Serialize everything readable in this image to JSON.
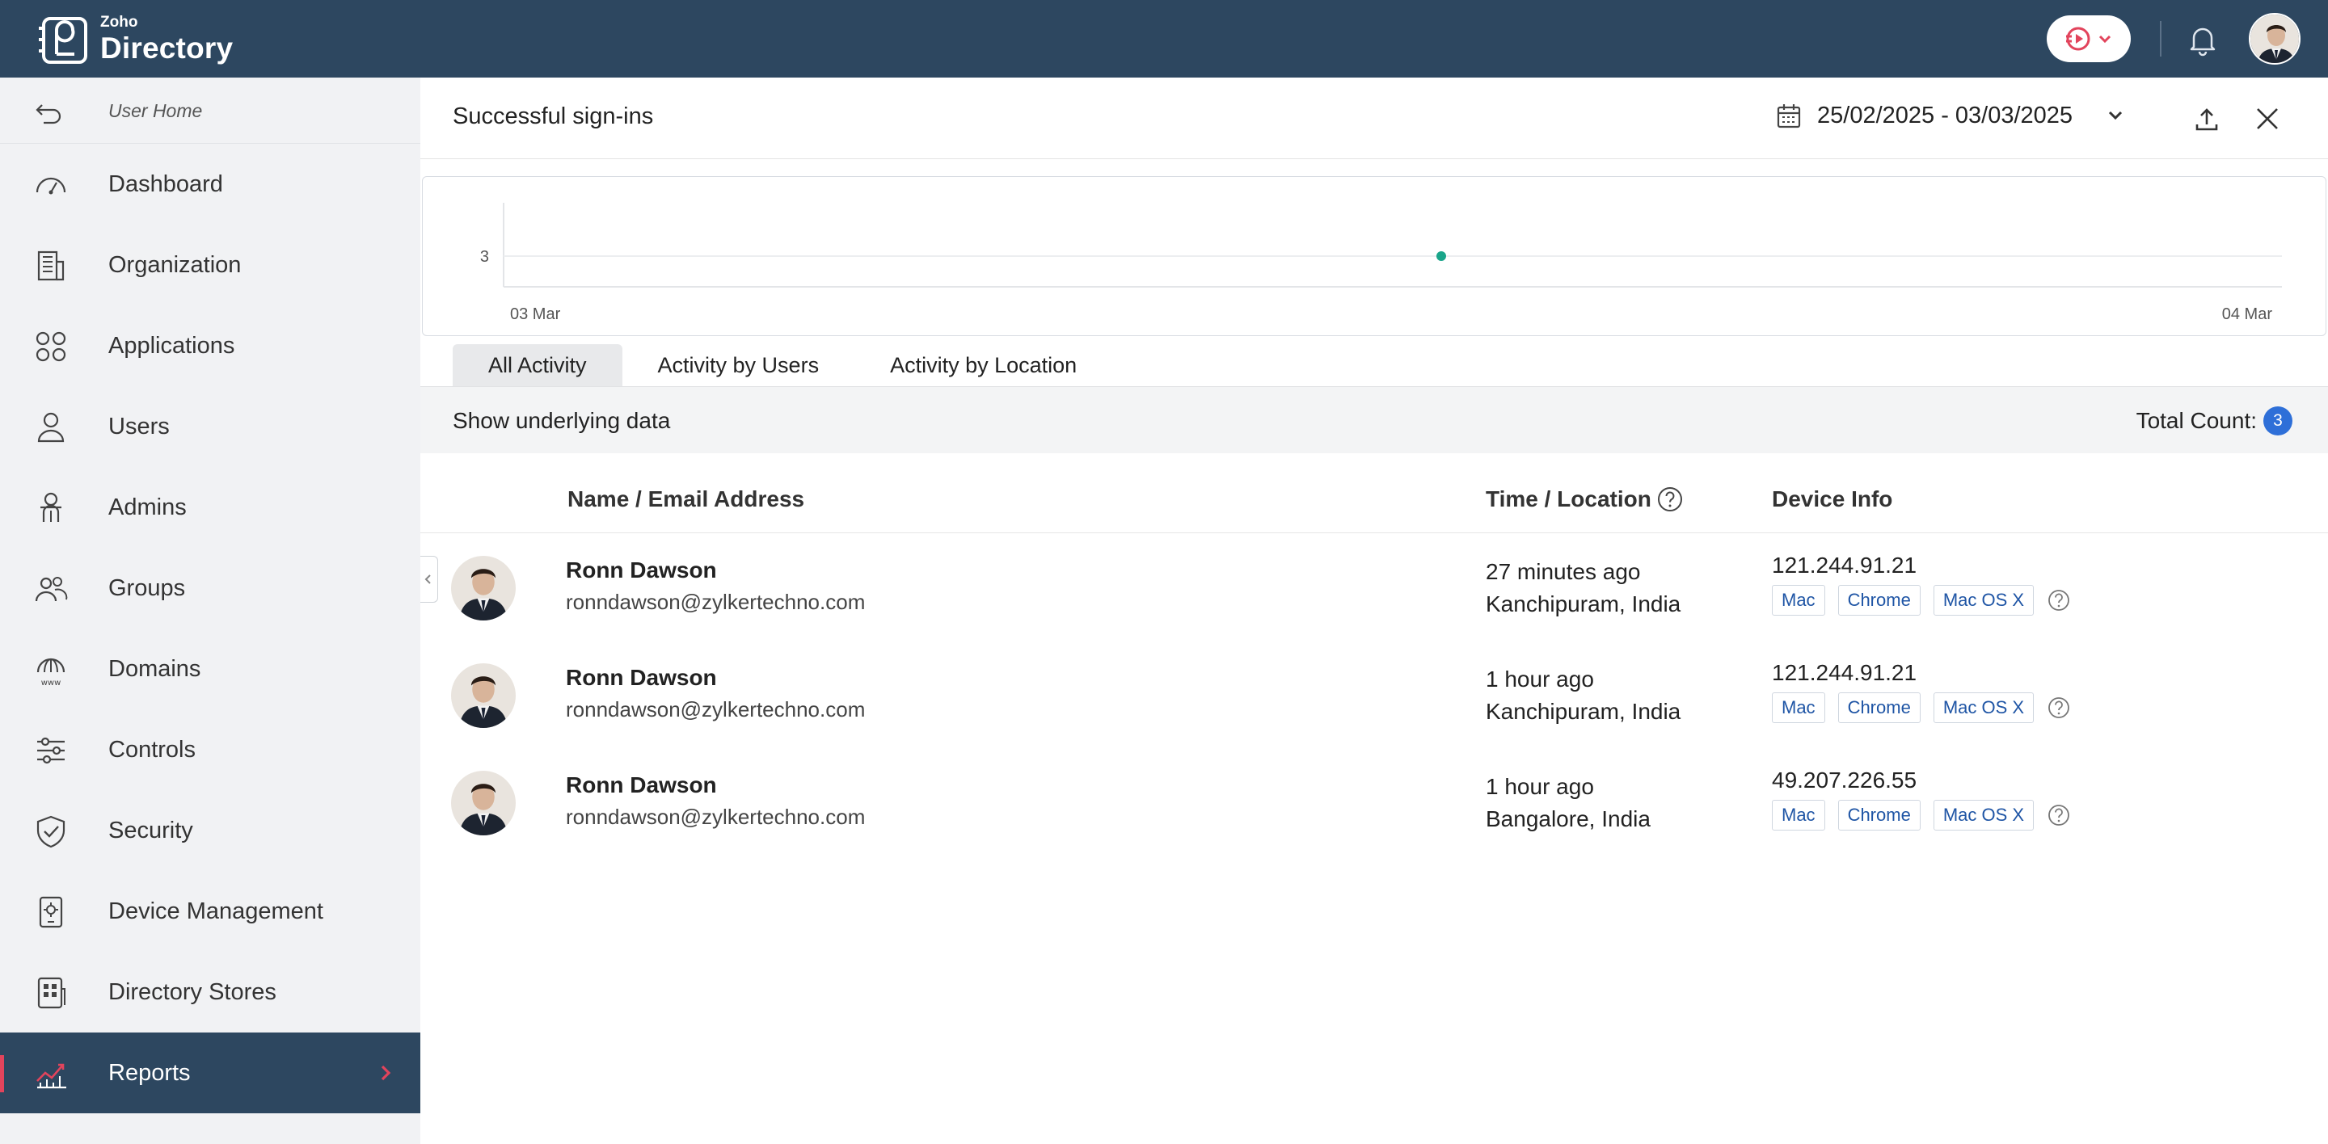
{
  "header": {
    "brand_small": "Zoho",
    "brand_name": "Directory",
    "bg_color": "#2d4760"
  },
  "sidebar": {
    "user_home": "User Home",
    "items": [
      {
        "label": "Dashboard",
        "icon": "speedometer-icon"
      },
      {
        "label": "Organization",
        "icon": "building-icon"
      },
      {
        "label": "Applications",
        "icon": "apps-grid-icon"
      },
      {
        "label": "Users",
        "icon": "user-icon"
      },
      {
        "label": "Admins",
        "icon": "admin-icon"
      },
      {
        "label": "Groups",
        "icon": "group-icon"
      },
      {
        "label": "Domains",
        "icon": "www-globe-icon"
      },
      {
        "label": "Controls",
        "icon": "sliders-icon"
      },
      {
        "label": "Security",
        "icon": "shield-check-icon"
      },
      {
        "label": "Device Management",
        "icon": "device-gear-icon"
      },
      {
        "label": "Directory Stores",
        "icon": "store-apps-icon"
      },
      {
        "label": "Reports",
        "icon": "trend-chart-icon",
        "active": true
      }
    ],
    "active_accent": "#e2445c"
  },
  "panel": {
    "title": "Successful sign-ins",
    "date_range": "25/02/2025 - 03/03/2025"
  },
  "chart_data": {
    "type": "scatter",
    "x_tick_labels": [
      "03 Mar",
      "04 Mar"
    ],
    "y_tick_labels": [
      "3"
    ],
    "points": [
      {
        "x": "03 Mar 12:00",
        "y": 3
      }
    ],
    "color": "#1aa58a",
    "grid": true
  },
  "tabs": [
    "All Activity",
    "Activity by Users",
    "Activity by Location"
  ],
  "active_tab": 0,
  "filterbar": {
    "show_label": "Show underlying data",
    "total_label": "Total Count:",
    "total_value": "3"
  },
  "table": {
    "columns": [
      "Name / Email Address",
      "Time / Location",
      "Device Info"
    ],
    "rows": [
      {
        "name": "Ronn Dawson",
        "email": "ronndawson@zylkertechno.com",
        "time": "27 minutes ago",
        "location": "Kanchipuram, India",
        "ip": "121.244.91.21",
        "tags": [
          "Mac",
          "Chrome",
          "Mac OS X"
        ]
      },
      {
        "name": "Ronn Dawson",
        "email": "ronndawson@zylkertechno.com",
        "time": "1 hour ago",
        "location": "Kanchipuram, India",
        "ip": "121.244.91.21",
        "tags": [
          "Mac",
          "Chrome",
          "Mac OS X"
        ]
      },
      {
        "name": "Ronn Dawson",
        "email": "ronndawson@zylkertechno.com",
        "time": "1 hour ago",
        "location": "Bangalore, India",
        "ip": "49.207.226.55",
        "tags": [
          "Mac",
          "Chrome",
          "Mac OS X"
        ]
      }
    ]
  }
}
